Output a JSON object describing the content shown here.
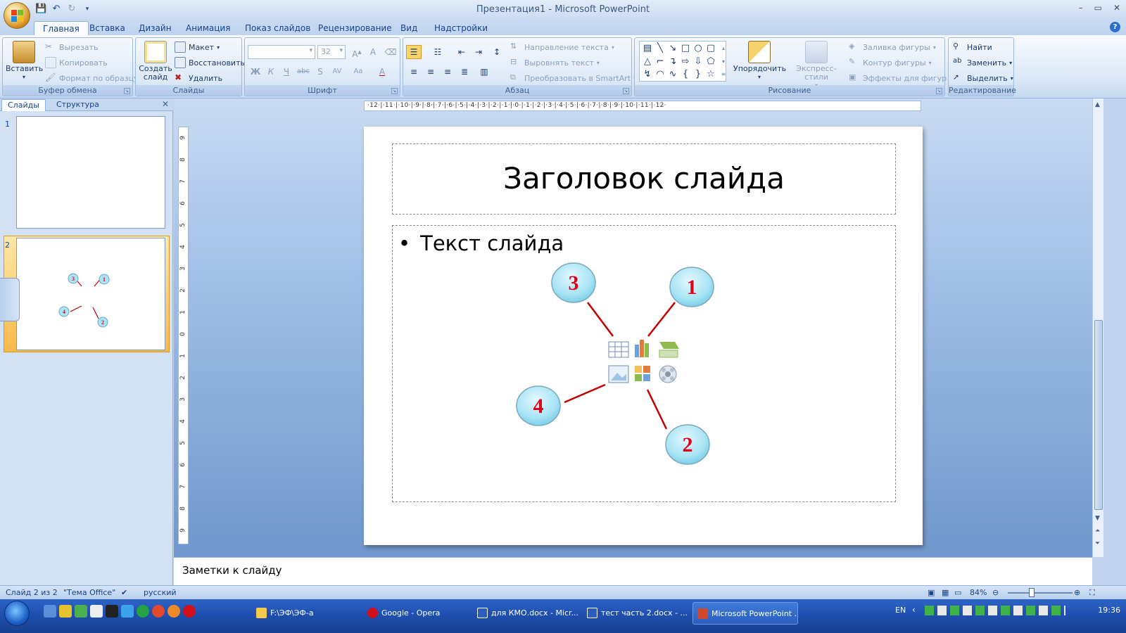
{
  "window": {
    "title": "Презентация1 - Microsoft PowerPoint"
  },
  "tabs": [
    "Главная",
    "Вставка",
    "Дизайн",
    "Анимация",
    "Показ слайдов",
    "Рецензирование",
    "Вид",
    "Надстройки"
  ],
  "ribbon": {
    "clipboard": {
      "label": "Буфер обмена",
      "paste": "Вставить",
      "cut": "Вырезать",
      "copy": "Копировать",
      "format_painter": "Формат по образцу"
    },
    "slides": {
      "label": "Слайды",
      "new_slide_line1": "Создать",
      "new_slide_line2": "слайд",
      "layout": "Макет",
      "reset": "Восстановить",
      "delete": "Удалить"
    },
    "font": {
      "label": "Шрифт",
      "size": "32"
    },
    "paragraph": {
      "label": "Абзац",
      "text_direction": "Направление текста",
      "align_text": "Выровнять текст",
      "smartart": "Преобразовать в SmartArt"
    },
    "drawing": {
      "label": "Рисование",
      "arrange": "Упорядочить",
      "quick_styles": "Экспресс-стили",
      "shape_fill": "Заливка фигуры",
      "shape_outline": "Контур фигуры",
      "shape_effects": "Эффекты для фигур"
    },
    "editing": {
      "label": "Редактирование",
      "find": "Найти",
      "replace": "Заменить",
      "select": "Выделить"
    }
  },
  "panel": {
    "tab_slides": "Слайды",
    "tab_outline": "Структура",
    "slide_numbers": [
      "1",
      "2"
    ]
  },
  "ruler": {
    "horizontal": "·12·|·11·|·10·|·9·|·8·|·7·|·6·|·5·|·4·|·3·|·2·|·1·|·0·|·1·|·2·|·3·|·4·|·5·|·6·|·7·|·8·|·9·|·10·|·11·|·12·",
    "vertical": [
      "9",
      "8",
      "7",
      "6",
      "5",
      "4",
      "3",
      "2",
      "1",
      "0",
      "1",
      "2",
      "3",
      "4",
      "5",
      "6",
      "7",
      "8",
      "9"
    ]
  },
  "slide": {
    "title": "Заголовок слайда",
    "body": "Текст слайда",
    "callouts": [
      {
        "label": "1",
        "x": 0,
        "y": 0
      },
      {
        "label": "2",
        "x": 0,
        "y": 0
      },
      {
        "label": "3",
        "x": 0,
        "y": 0
      },
      {
        "label": "4",
        "x": 0,
        "y": 0
      }
    ]
  },
  "notes": {
    "placeholder": "Заметки к слайду"
  },
  "status": {
    "slide_info": "Слайд 2 из 2",
    "theme": "\"Тема Office\"",
    "language": "русский",
    "zoom": "84%"
  },
  "taskbar": {
    "items": [
      "F:\\ЭФ\\ЭФ-а",
      "Google - Opera",
      "для КМО.docx - Micr...",
      "тест часть 2.docx - ...",
      "Microsoft PowerPoint ..."
    ],
    "lang": "EN",
    "clock": "19:36"
  },
  "colors": {
    "callout_fill": "#a8e4f5",
    "callout_text": "#e0001a",
    "connector": "#c00000",
    "selected_thumb": "#f8b94a"
  }
}
